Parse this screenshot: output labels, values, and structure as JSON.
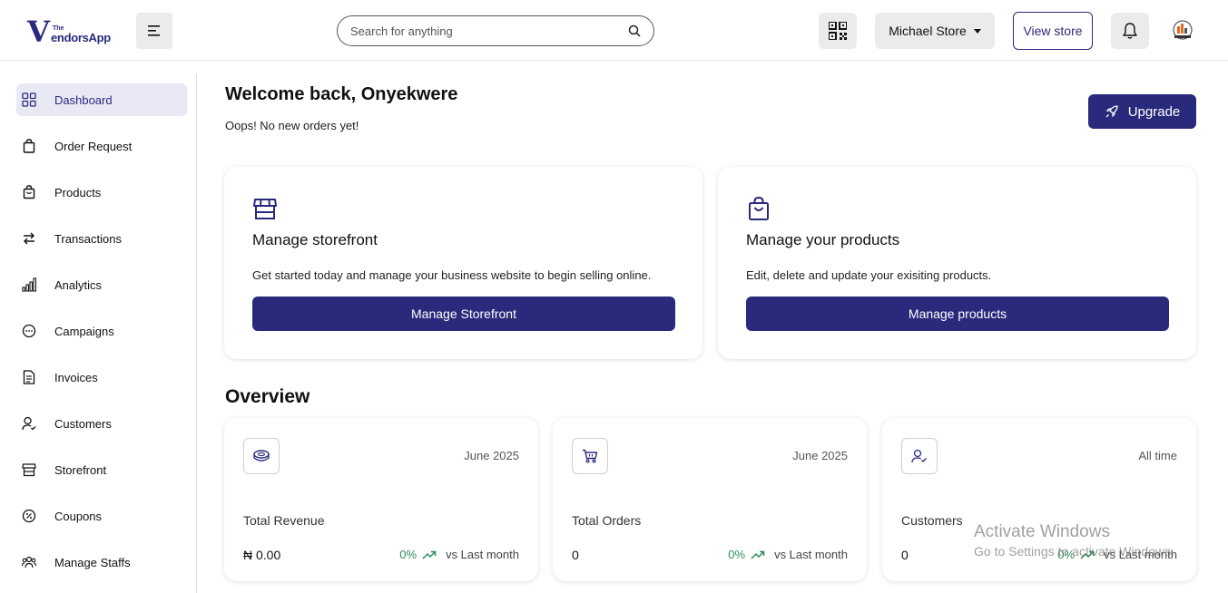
{
  "brand": {
    "the": "The",
    "v": "V",
    "name": "endorsApp"
  },
  "header": {
    "search_placeholder": "Search for anything",
    "store_name": "Michael Store",
    "view_store": "View store"
  },
  "sidebar": {
    "items": [
      {
        "label": "Dashboard",
        "icon": "dashboard-grid-icon",
        "active": true
      },
      {
        "label": "Order Request",
        "icon": "shopping-bag-icon"
      },
      {
        "label": "Products",
        "icon": "product-bag-icon"
      },
      {
        "label": "Transactions",
        "icon": "transfer-arrows-icon"
      },
      {
        "label": "Analytics",
        "icon": "bar-chart-icon"
      },
      {
        "label": "Campaigns",
        "icon": "chat-bubble-icon"
      },
      {
        "label": "Invoices",
        "icon": "invoice-icon"
      },
      {
        "label": "Customers",
        "icon": "user-check-icon"
      },
      {
        "label": "Storefront",
        "icon": "storefront-icon"
      },
      {
        "label": "Coupons",
        "icon": "coupon-icon"
      },
      {
        "label": "Manage Staffs",
        "icon": "staff-group-icon"
      }
    ]
  },
  "main": {
    "welcome": "Welcome back, Onyekwere",
    "subtitle": "Oops! No new orders yet!",
    "upgrade_label": "Upgrade",
    "manage_cards": [
      {
        "title": "Manage storefront",
        "description": "Get started today and manage your business website to begin selling online.",
        "button": "Manage Storefront",
        "icon": "storefront-icon"
      },
      {
        "title": "Manage your products",
        "description": "Edit, delete and update your exisiting products.",
        "button": "Manage products",
        "icon": "shopping-bag-icon"
      }
    ],
    "overview_title": "Overview",
    "stats": [
      {
        "period": "June 2025",
        "label": "Total Revenue",
        "value": "₦ 0.00",
        "pct": "0%",
        "vs": "vs Last month",
        "icon": "coins-icon"
      },
      {
        "period": "June 2025",
        "label": "Total Orders",
        "value": "0",
        "pct": "0%",
        "vs": "vs Last month",
        "icon": "cart-icon"
      },
      {
        "period": "All time",
        "label": "Customers",
        "value": "0",
        "pct": "0%",
        "vs": "vs Last month",
        "icon": "user-check-icon"
      }
    ]
  },
  "watermark": {
    "line1": "Activate Windows",
    "line2": "Go to Settings to activate Windows."
  },
  "colors": {
    "primary": "#2a2a7d",
    "trend": "#2e8b57",
    "active_bg": "#e9e9f6"
  }
}
